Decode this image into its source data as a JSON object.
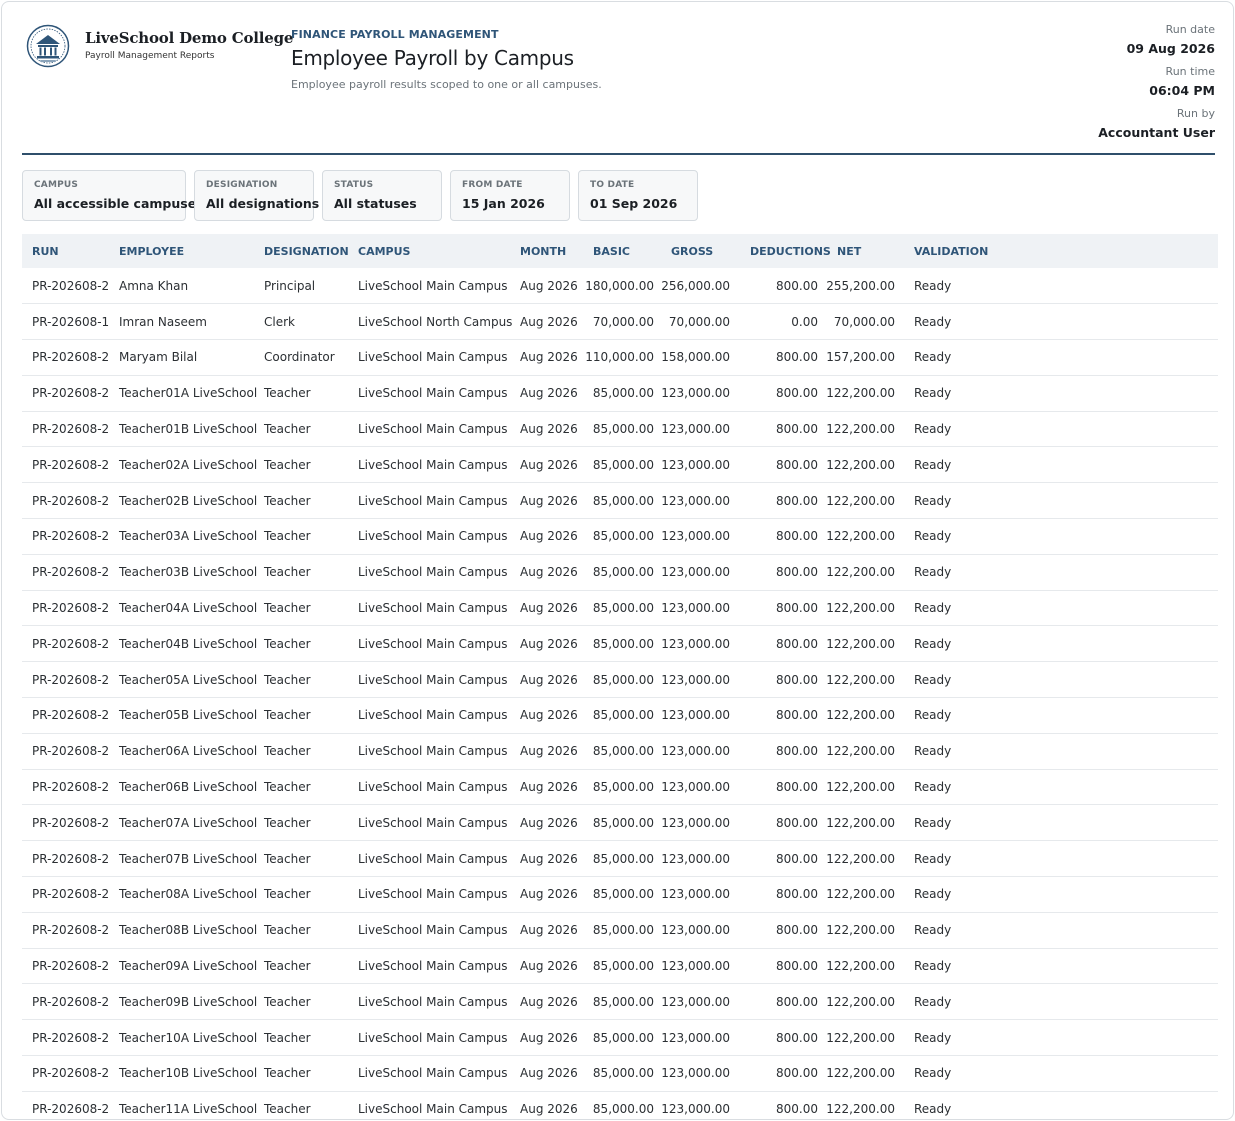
{
  "header": {
    "college_name": "LiveSchool Demo College",
    "college_subtitle": "Payroll Management Reports",
    "eyebrow": "FINANCE PAYROLL MANAGEMENT",
    "title": "Employee Payroll by Campus",
    "subtitle": "Employee payroll results scoped to one or all campuses.",
    "run_date_label": "Run date",
    "run_date": "09 Aug 2026",
    "run_time_label": "Run time",
    "run_time": "06:04 PM",
    "run_by_label": "Run by",
    "run_by": "Accountant User"
  },
  "filters": [
    {
      "label": "CAMPUS",
      "value": "All accessible campuses"
    },
    {
      "label": "DESIGNATION",
      "value": "All designations"
    },
    {
      "label": "STATUS",
      "value": "All statuses"
    },
    {
      "label": "FROM DATE",
      "value": "15 Jan 2026"
    },
    {
      "label": "TO DATE",
      "value": "01 Sep 2026"
    }
  ],
  "table": {
    "columns": [
      "RUN",
      "EMPLOYEE",
      "DESIGNATION",
      "CAMPUS",
      "MONTH",
      "BASIC",
      "GROSS",
      "DEDUCTIONS",
      "NET",
      "VALIDATION"
    ],
    "rows": [
      [
        "PR-202608-2",
        "Amna Khan",
        "Principal",
        "LiveSchool Main Campus",
        "Aug 2026",
        "180,000.00",
        "256,000.00",
        "800.00",
        "255,200.00",
        "Ready"
      ],
      [
        "PR-202608-1",
        "Imran Naseem",
        "Clerk",
        "LiveSchool North Campus",
        "Aug 2026",
        "70,000.00",
        "70,000.00",
        "0.00",
        "70,000.00",
        "Ready"
      ],
      [
        "PR-202608-2",
        "Maryam Bilal",
        "Coordinator",
        "LiveSchool Main Campus",
        "Aug 2026",
        "110,000.00",
        "158,000.00",
        "800.00",
        "157,200.00",
        "Ready"
      ],
      [
        "PR-202608-2",
        "Teacher01A LiveSchool",
        "Teacher",
        "LiveSchool Main Campus",
        "Aug 2026",
        "85,000.00",
        "123,000.00",
        "800.00",
        "122,200.00",
        "Ready"
      ],
      [
        "PR-202608-2",
        "Teacher01B LiveSchool",
        "Teacher",
        "LiveSchool Main Campus",
        "Aug 2026",
        "85,000.00",
        "123,000.00",
        "800.00",
        "122,200.00",
        "Ready"
      ],
      [
        "PR-202608-2",
        "Teacher02A LiveSchool",
        "Teacher",
        "LiveSchool Main Campus",
        "Aug 2026",
        "85,000.00",
        "123,000.00",
        "800.00",
        "122,200.00",
        "Ready"
      ],
      [
        "PR-202608-2",
        "Teacher02B LiveSchool",
        "Teacher",
        "LiveSchool Main Campus",
        "Aug 2026",
        "85,000.00",
        "123,000.00",
        "800.00",
        "122,200.00",
        "Ready"
      ],
      [
        "PR-202608-2",
        "Teacher03A LiveSchool",
        "Teacher",
        "LiveSchool Main Campus",
        "Aug 2026",
        "85,000.00",
        "123,000.00",
        "800.00",
        "122,200.00",
        "Ready"
      ],
      [
        "PR-202608-2",
        "Teacher03B LiveSchool",
        "Teacher",
        "LiveSchool Main Campus",
        "Aug 2026",
        "85,000.00",
        "123,000.00",
        "800.00",
        "122,200.00",
        "Ready"
      ],
      [
        "PR-202608-2",
        "Teacher04A LiveSchool",
        "Teacher",
        "LiveSchool Main Campus",
        "Aug 2026",
        "85,000.00",
        "123,000.00",
        "800.00",
        "122,200.00",
        "Ready"
      ],
      [
        "PR-202608-2",
        "Teacher04B LiveSchool",
        "Teacher",
        "LiveSchool Main Campus",
        "Aug 2026",
        "85,000.00",
        "123,000.00",
        "800.00",
        "122,200.00",
        "Ready"
      ],
      [
        "PR-202608-2",
        "Teacher05A LiveSchool",
        "Teacher",
        "LiveSchool Main Campus",
        "Aug 2026",
        "85,000.00",
        "123,000.00",
        "800.00",
        "122,200.00",
        "Ready"
      ],
      [
        "PR-202608-2",
        "Teacher05B LiveSchool",
        "Teacher",
        "LiveSchool Main Campus",
        "Aug 2026",
        "85,000.00",
        "123,000.00",
        "800.00",
        "122,200.00",
        "Ready"
      ],
      [
        "PR-202608-2",
        "Teacher06A LiveSchool",
        "Teacher",
        "LiveSchool Main Campus",
        "Aug 2026",
        "85,000.00",
        "123,000.00",
        "800.00",
        "122,200.00",
        "Ready"
      ],
      [
        "PR-202608-2",
        "Teacher06B LiveSchool",
        "Teacher",
        "LiveSchool Main Campus",
        "Aug 2026",
        "85,000.00",
        "123,000.00",
        "800.00",
        "122,200.00",
        "Ready"
      ],
      [
        "PR-202608-2",
        "Teacher07A LiveSchool",
        "Teacher",
        "LiveSchool Main Campus",
        "Aug 2026",
        "85,000.00",
        "123,000.00",
        "800.00",
        "122,200.00",
        "Ready"
      ],
      [
        "PR-202608-2",
        "Teacher07B LiveSchool",
        "Teacher",
        "LiveSchool Main Campus",
        "Aug 2026",
        "85,000.00",
        "123,000.00",
        "800.00",
        "122,200.00",
        "Ready"
      ],
      [
        "PR-202608-2",
        "Teacher08A LiveSchool",
        "Teacher",
        "LiveSchool Main Campus",
        "Aug 2026",
        "85,000.00",
        "123,000.00",
        "800.00",
        "122,200.00",
        "Ready"
      ],
      [
        "PR-202608-2",
        "Teacher08B LiveSchool",
        "Teacher",
        "LiveSchool Main Campus",
        "Aug 2026",
        "85,000.00",
        "123,000.00",
        "800.00",
        "122,200.00",
        "Ready"
      ],
      [
        "PR-202608-2",
        "Teacher09A LiveSchool",
        "Teacher",
        "LiveSchool Main Campus",
        "Aug 2026",
        "85,000.00",
        "123,000.00",
        "800.00",
        "122,200.00",
        "Ready"
      ],
      [
        "PR-202608-2",
        "Teacher09B LiveSchool",
        "Teacher",
        "LiveSchool Main Campus",
        "Aug 2026",
        "85,000.00",
        "123,000.00",
        "800.00",
        "122,200.00",
        "Ready"
      ],
      [
        "PR-202608-2",
        "Teacher10A LiveSchool",
        "Teacher",
        "LiveSchool Main Campus",
        "Aug 2026",
        "85,000.00",
        "123,000.00",
        "800.00",
        "122,200.00",
        "Ready"
      ],
      [
        "PR-202608-2",
        "Teacher10B LiveSchool",
        "Teacher",
        "LiveSchool Main Campus",
        "Aug 2026",
        "85,000.00",
        "123,000.00",
        "800.00",
        "122,200.00",
        "Ready"
      ],
      [
        "PR-202608-2",
        "Teacher11A LiveSchool",
        "Teacher",
        "LiveSchool Main Campus",
        "Aug 2026",
        "85,000.00",
        "123,000.00",
        "800.00",
        "122,200.00",
        "Ready"
      ]
    ]
  },
  "colors": {
    "accent": "#2f5578",
    "rule": "#2f4f6b",
    "header_row": "#eff2f5",
    "text": "#2b2f33"
  },
  "icons": {
    "logo": "college-crest-icon"
  }
}
